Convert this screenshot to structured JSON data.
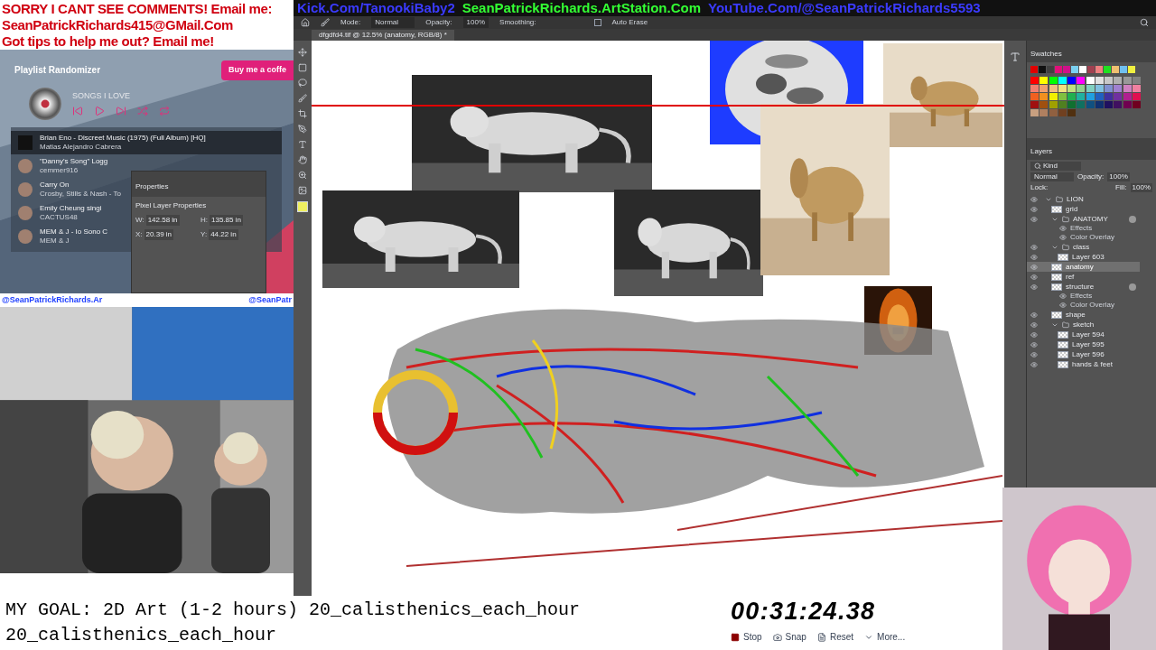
{
  "overlay_banner": [
    "SORRY I CANT SEE COMMENTS! Email me:",
    "SeanPatrickRichards415@GMail.Com",
    "Got tips to help me out? Email me!"
  ],
  "links": [
    {
      "text": "Kick.Com/TanookiBaby2",
      "color": "#3b3bff"
    },
    {
      "text": "SeanPatrickRichards.ArtStation.Com",
      "color": "#33ff33"
    },
    {
      "text": "YouTube.Com/@SeanPatrickRichards5593",
      "color": "#3b3bff"
    }
  ],
  "playlist": {
    "title": "Playlist Randomizer",
    "coffee_button": "Buy me a coffe",
    "name": "SONGS I LOVE",
    "songs": [
      {
        "title": "Brian Eno - Discreet Music (1975) (Full Album) [HQ]",
        "artist": "Matias Alejandro Cabrera",
        "selected": true
      },
      {
        "title": "\"Danny's Song\" Logg",
        "artist": "cemmer916",
        "selected": false
      },
      {
        "title": "Carry On",
        "artist": "Crosby, Stills & Nash - To",
        "selected": false
      },
      {
        "title": "Emily Cheung singi",
        "artist": "CACTUS48",
        "selected": false
      },
      {
        "title": "MEM & J - Io Sono C",
        "artist": "MEM & J",
        "selected": false
      }
    ]
  },
  "properties_panel": {
    "title": "Properties",
    "subtitle": "Pixel Layer Properties",
    "fields": [
      {
        "label": "W:",
        "value": "142.58 in"
      },
      {
        "label": "H:",
        "value": "135.85 in"
      },
      {
        "label": "X:",
        "value": "20.39 in"
      },
      {
        "label": "Y:",
        "value": "44.22 in"
      }
    ]
  },
  "webcam_handles": [
    "@SeanPatrickRichards.Ar",
    "@SeanPatr"
  ],
  "options_bar": {
    "mode_label": "Mode:",
    "mode": "Normal",
    "opacity_label": "Opacity:",
    "opacity": "100%",
    "smoothing_label": "Smoothing:",
    "auto_erase": {
      "label": "Auto Erase",
      "checked": false
    }
  },
  "document_tab": "dfgdfd4.tif @ 12.5% (anatomy, RGB/8) *",
  "swatches": {
    "title": "Swatches",
    "recent": [
      {
        "color": "#e00000"
      },
      {
        "color": "#101010"
      },
      {
        "color": "#404040"
      },
      {
        "color": "#e0107a"
      },
      {
        "color": "#d0108a"
      },
      {
        "color": "#7ad0f0"
      },
      {
        "color": "#ffffff"
      },
      {
        "color": "#a04050"
      },
      {
        "color": "#f08080"
      },
      {
        "color": "#20e020"
      },
      {
        "color": "#f0c070"
      },
      {
        "color": "#70c0f0"
      },
      {
        "color": "#f0f040"
      }
    ],
    "grid": [
      {
        "color": "#ff0000"
      },
      {
        "color": "#ffff00"
      },
      {
        "color": "#00ff00"
      },
      {
        "color": "#00ffff"
      },
      {
        "color": "#0000ff"
      },
      {
        "color": "#ff00ff"
      },
      {
        "color": "#ffffff"
      },
      {
        "color": "#e0e0e0"
      },
      {
        "color": "#c8c8c8"
      },
      {
        "color": "#b0b0b0"
      },
      {
        "color": "#989898"
      },
      {
        "color": "#808080"
      },
      {
        "color": "#f08070"
      },
      {
        "color": "#f0a070"
      },
      {
        "color": "#f0c080"
      },
      {
        "color": "#f0e080"
      },
      {
        "color": "#c0e080"
      },
      {
        "color": "#90d090"
      },
      {
        "color": "#80d0c0"
      },
      {
        "color": "#80c0e0"
      },
      {
        "color": "#8090d0"
      },
      {
        "color": "#a080d0"
      },
      {
        "color": "#d080c0"
      },
      {
        "color": "#f080a0"
      },
      {
        "color": "#f06020"
      },
      {
        "color": "#f09020"
      },
      {
        "color": "#f0f000"
      },
      {
        "color": "#80c040"
      },
      {
        "color": "#20b050"
      },
      {
        "color": "#20b0a0"
      },
      {
        "color": "#20a0e0"
      },
      {
        "color": "#2060c0"
      },
      {
        "color": "#4030a0"
      },
      {
        "color": "#7030a0"
      },
      {
        "color": "#b02090"
      },
      {
        "color": "#e01050"
      },
      {
        "color": "#a01010"
      },
      {
        "color": "#a05010"
      },
      {
        "color": "#a0a000"
      },
      {
        "color": "#508020"
      },
      {
        "color": "#107030"
      },
      {
        "color": "#107060"
      },
      {
        "color": "#105080"
      },
      {
        "color": "#103070"
      },
      {
        "color": "#201060"
      },
      {
        "color": "#401060"
      },
      {
        "color": "#700050"
      },
      {
        "color": "#700020"
      },
      {
        "color": "#c8a080"
      },
      {
        "color": "#b08060"
      },
      {
        "color": "#906040"
      },
      {
        "color": "#704020"
      },
      {
        "color": "#503010"
      }
    ]
  },
  "layers": {
    "title": "Layers",
    "filter": "Kind",
    "blend": "Normal",
    "opacity_label": "Opacity:",
    "opacity": "100%",
    "lock_label": "Lock:",
    "fill_label": "Fill:",
    "fill": "100%",
    "items": [
      {
        "kind": "group",
        "name": "LION",
        "selected": false,
        "fx": false,
        "children": [
          {
            "kind": "layer",
            "name": "grid",
            "selected": false,
            "fx": false
          },
          {
            "kind": "group",
            "name": "ANATOMY",
            "selected": false,
            "fx": true,
            "children": [
              {
                "kind": "effect",
                "name": "Effects"
              },
              {
                "kind": "effect",
                "name": "Color Overlay"
              }
            ]
          },
          {
            "kind": "group",
            "name": "class",
            "selected": false,
            "fx": false,
            "children": [
              {
                "kind": "layer",
                "name": "Layer 603",
                "selected": false,
                "fx": false
              }
            ]
          },
          {
            "kind": "layer",
            "name": "anatomy",
            "selected": true,
            "fx": false
          },
          {
            "kind": "layer",
            "name": "ref",
            "selected": false,
            "fx": false
          },
          {
            "kind": "layer",
            "name": "structure",
            "selected": false,
            "fx": true,
            "children": [
              {
                "kind": "effect",
                "name": "Effects"
              },
              {
                "kind": "effect",
                "name": "Color Overlay"
              }
            ]
          },
          {
            "kind": "layer",
            "name": "shape",
            "selected": false,
            "fx": false
          },
          {
            "kind": "group",
            "name": "sketch",
            "selected": false,
            "fx": false,
            "children": [
              {
                "kind": "layer",
                "name": "Layer 594",
                "selected": false,
                "fx": false
              },
              {
                "kind": "layer",
                "name": "Layer 595",
                "selected": false,
                "fx": false
              },
              {
                "kind": "layer",
                "name": "Layer 596",
                "selected": false,
                "fx": false
              },
              {
                "kind": "layer",
                "name": "hands & feet",
                "selected": false,
                "fx": false
              }
            ]
          }
        ]
      }
    ]
  },
  "goal": [
    "MY GOAL: 2D Art (1-2 hours) 20_calisthenics_each_hour",
    "20_calisthenics_each_hour"
  ],
  "stopwatch": {
    "time": "00:31:24.38",
    "buttons": [
      {
        "kind": "stop",
        "label": "Stop"
      },
      {
        "kind": "snap",
        "label": "Snap"
      },
      {
        "kind": "reset",
        "label": "Reset"
      },
      {
        "kind": "more",
        "label": "More..."
      }
    ]
  }
}
